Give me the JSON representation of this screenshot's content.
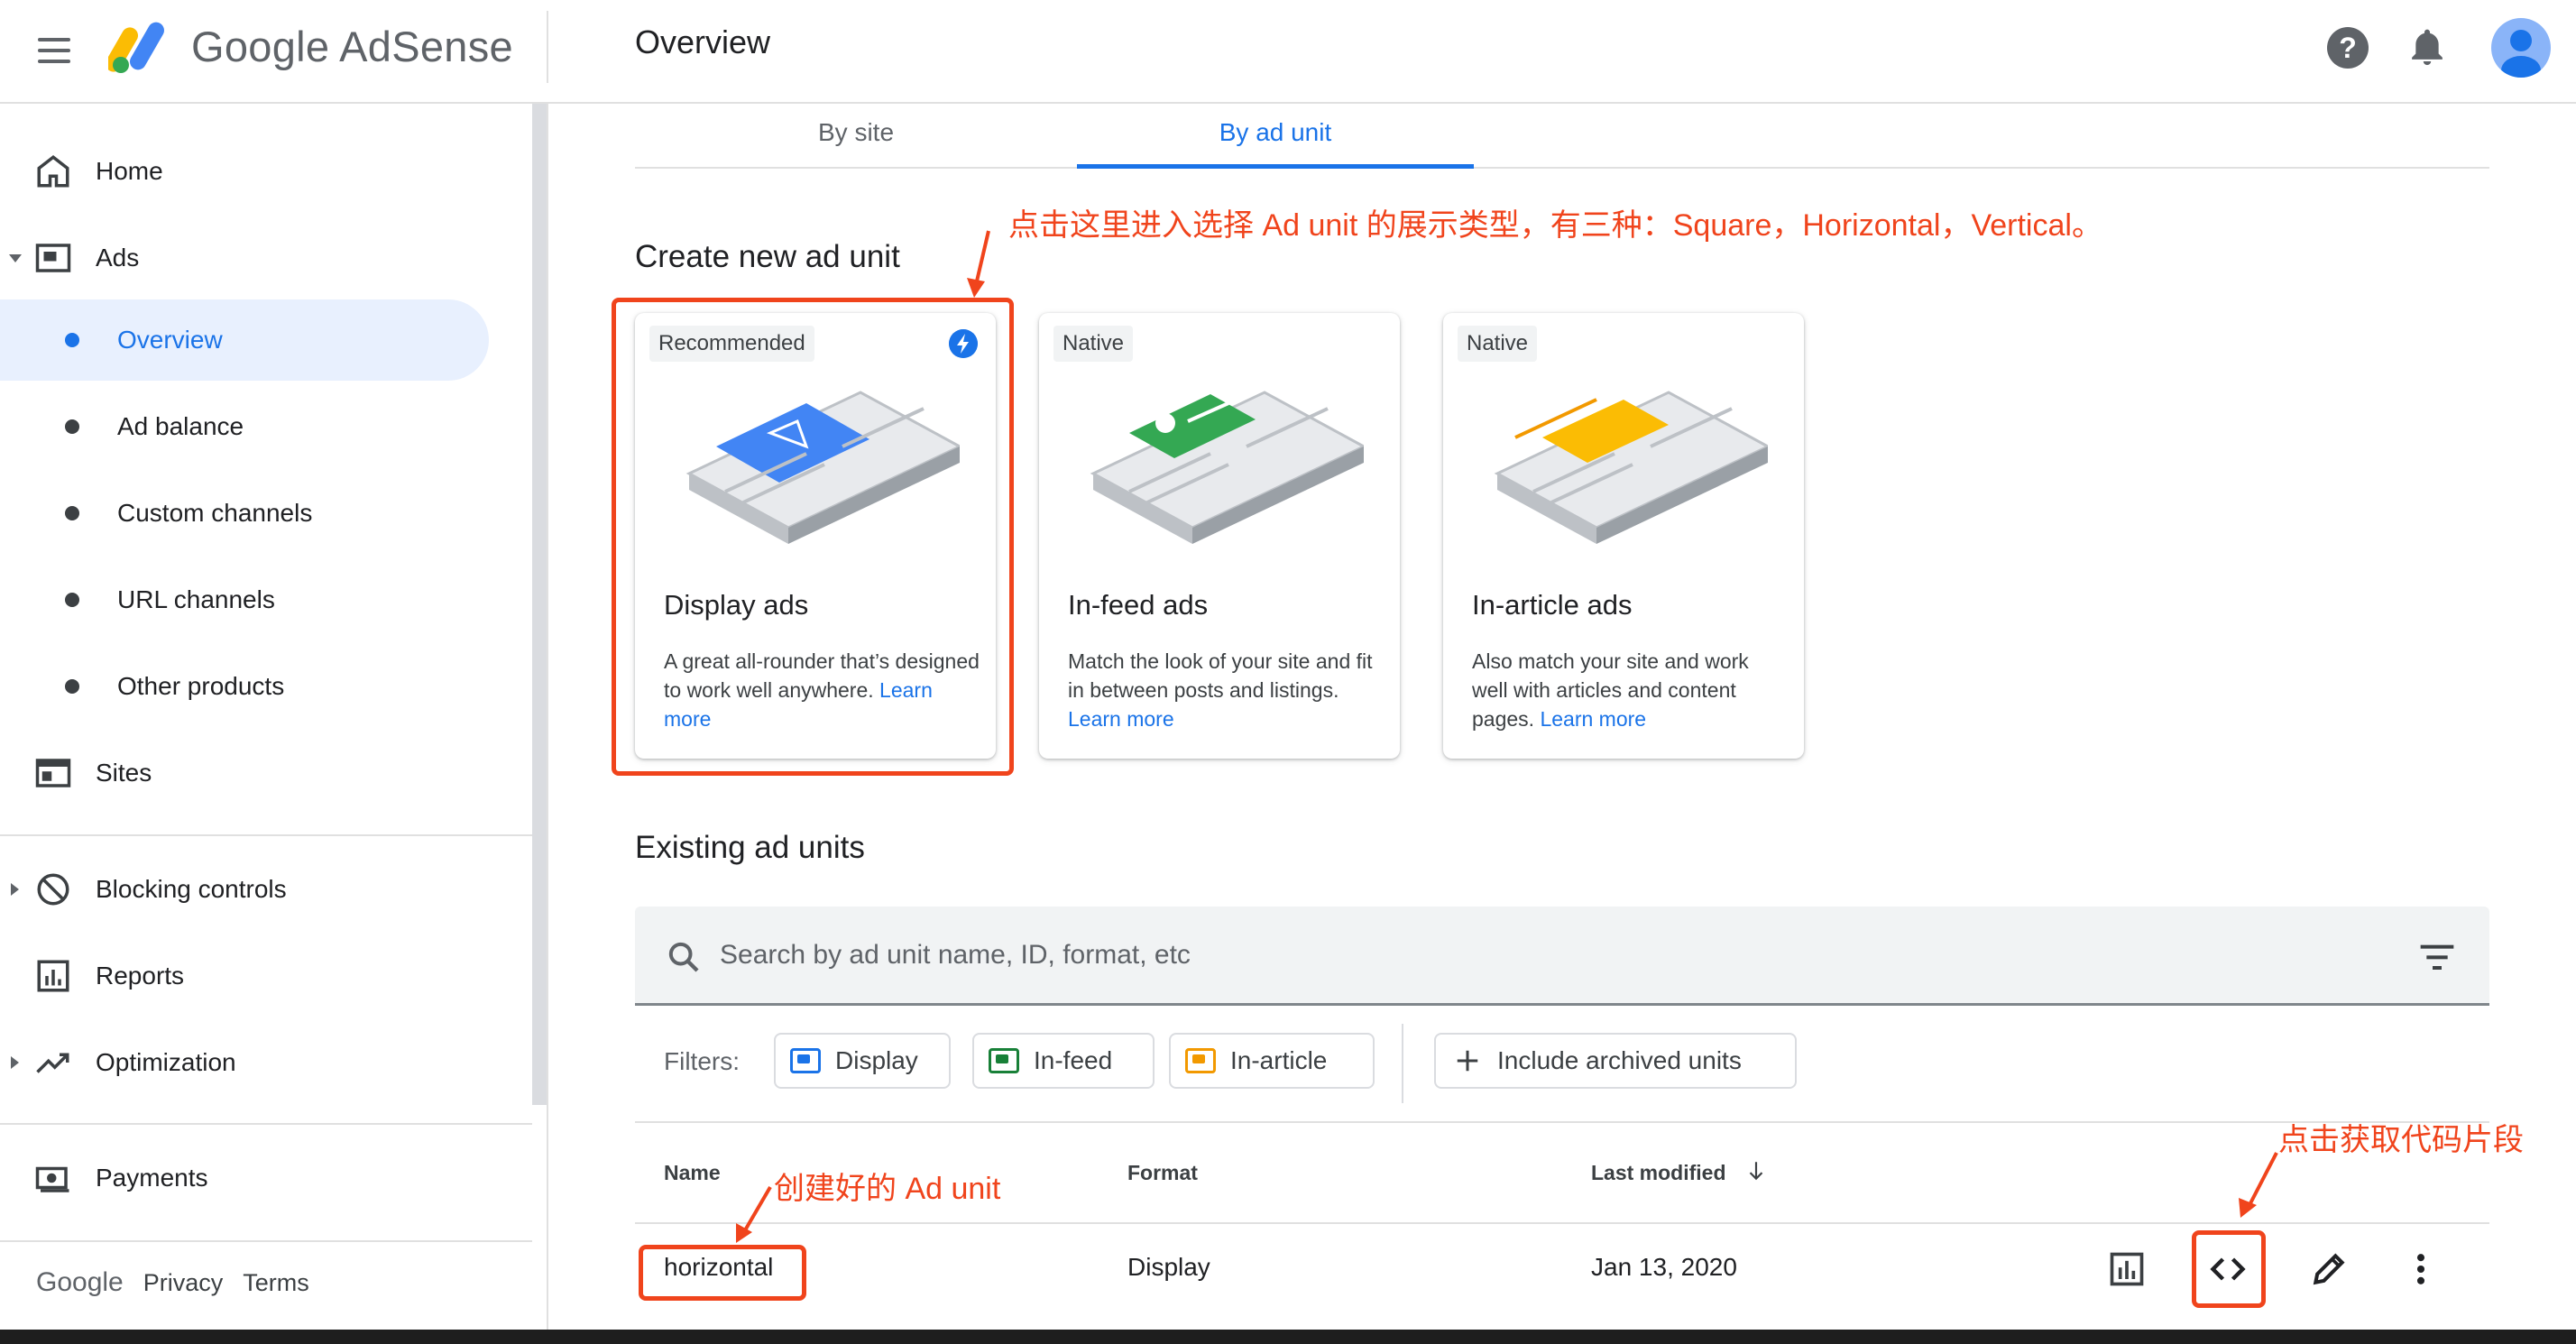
{
  "app": {
    "brand": "Google AdSense",
    "page_title": "Overview"
  },
  "header": {
    "icons": [
      "menu-icon",
      "adsense-logo",
      "help-icon",
      "notifications-icon",
      "account-avatar"
    ]
  },
  "sidebar": {
    "items": [
      {
        "label": "Home",
        "icon": "home-icon"
      },
      {
        "label": "Ads",
        "icon": "ads-icon",
        "expanded": true
      },
      {
        "label": "Overview",
        "sub": true,
        "active": true
      },
      {
        "label": "Ad balance",
        "sub": true
      },
      {
        "label": "Custom channels",
        "sub": true
      },
      {
        "label": "URL channels",
        "sub": true
      },
      {
        "label": "Other products",
        "sub": true
      },
      {
        "label": "Sites",
        "icon": "sites-icon"
      },
      {
        "label": "Blocking controls",
        "icon": "block-icon"
      },
      {
        "label": "Reports",
        "icon": "reports-icon"
      },
      {
        "label": "Optimization",
        "icon": "optimization-icon"
      },
      {
        "label": "Payments",
        "icon": "payments-icon"
      }
    ],
    "footer": {
      "google": "Google",
      "privacy": "Privacy",
      "terms": "Terms"
    }
  },
  "tabs": [
    {
      "label": "By site",
      "active": false
    },
    {
      "label": "By ad unit",
      "active": true
    }
  ],
  "create": {
    "title": "Create new ad unit",
    "cards": [
      {
        "badge": "Recommended",
        "title": "Display ads",
        "desc": "A great all-rounder that’s designed to work well anywhere.",
        "learn": "Learn more",
        "accent": "#4285f4"
      },
      {
        "badge": "Native",
        "title": "In-feed ads",
        "desc": "Match the look of your site and fit in between posts and listings.",
        "learn": "Learn more",
        "accent": "#34a853"
      },
      {
        "badge": "Native",
        "title": "In-article ads",
        "desc": "Also match your site and work well with articles and content pages.",
        "learn": "Learn more",
        "accent": "#fbbc04"
      }
    ]
  },
  "existing": {
    "title": "Existing ad units",
    "search_placeholder": "Search by ad unit name, ID, format, etc",
    "filters_label": "Filters:",
    "chips": [
      {
        "label": "Display",
        "color": "#1a73e8"
      },
      {
        "label": "In-feed",
        "color": "#188038"
      },
      {
        "label": "In-article",
        "color": "#f29900"
      },
      {
        "label": "Include archived units",
        "color": ""
      }
    ],
    "columns": {
      "name": "Name",
      "format": "Format",
      "modified": "Last modified"
    },
    "rows": [
      {
        "name": "horizontal",
        "format": "Display",
        "modified": "Jan 13, 2020"
      }
    ]
  },
  "annotations": {
    "create_note": "点击这里进入选择 Ad unit 的展示类型，有三种：Square，Horizontal，Vertical。",
    "unit_note": "创建好的 Ad unit",
    "code_note": "点击获取代码片段",
    "color": "#f0441c"
  },
  "colors": {
    "accent_blue": "#1a73e8",
    "active_bg": "#e8f0fe",
    "annotation": "#f0441c"
  }
}
